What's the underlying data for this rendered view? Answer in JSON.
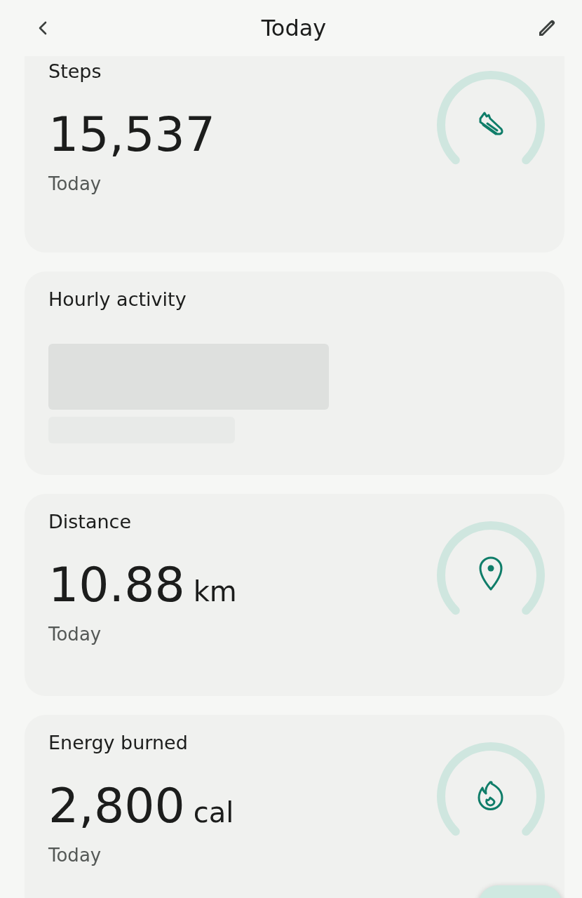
{
  "header": {
    "title": "Today"
  },
  "cards": [
    {
      "kind": "steps",
      "title": "Steps",
      "value": "15,537",
      "period": "Today"
    },
    {
      "kind": "loading",
      "title": "Hourly activity"
    },
    {
      "kind": "distance",
      "title": "Distance",
      "value": "10.88",
      "unit": "km",
      "period": "Today"
    },
    {
      "kind": "energy",
      "title": "Energy burned",
      "value": "2,800",
      "unit": "cal",
      "period": "Today"
    }
  ]
}
